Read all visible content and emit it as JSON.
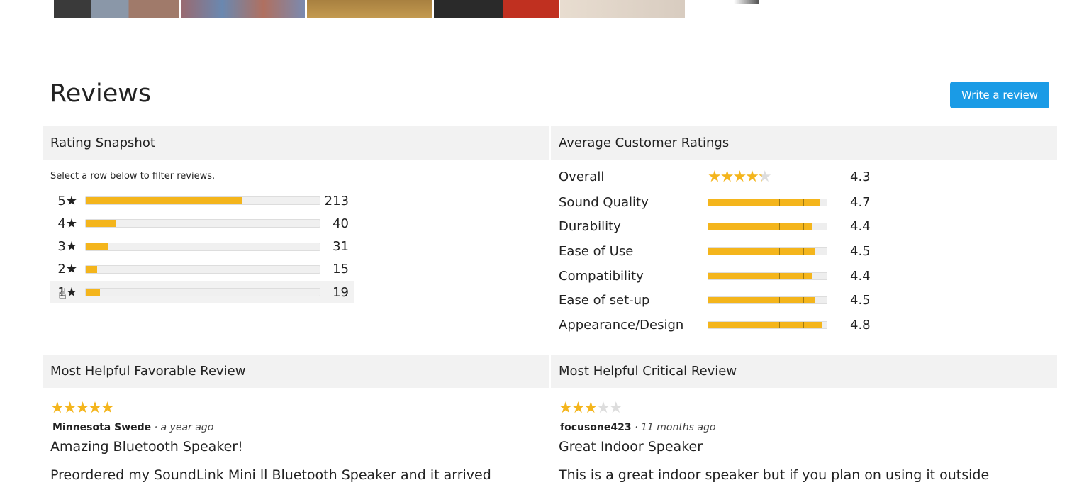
{
  "photos": [
    "photo-1",
    "photo-2",
    "photo-3",
    "photo-4",
    "photo-5"
  ],
  "reviews_title": "Reviews",
  "write_review_label": "Write a review",
  "snapshot": {
    "title": "Rating Snapshot",
    "hint": "Select a row below to filter reviews.",
    "rows": [
      {
        "label": "5★",
        "count": "213",
        "fraction": 0.67
      },
      {
        "label": "4★",
        "count": "40",
        "fraction": 0.126
      },
      {
        "label": "3★",
        "count": "31",
        "fraction": 0.098
      },
      {
        "label": "2★",
        "count": "15",
        "fraction": 0.047
      },
      {
        "label": "1★",
        "count": "19",
        "fraction": 0.06
      }
    ]
  },
  "averages": {
    "title": "Average Customer Ratings",
    "overall": {
      "label": "Overall",
      "value": "4.3"
    },
    "items": [
      {
        "label": "Sound Quality",
        "value": "4.7"
      },
      {
        "label": "Durability",
        "value": "4.4"
      },
      {
        "label": "Ease of Use",
        "value": "4.5"
      },
      {
        "label": "Compatibility",
        "value": "4.4"
      },
      {
        "label": "Ease of set-up",
        "value": "4.5"
      },
      {
        "label": "Appearance/Design",
        "value": "4.8"
      }
    ]
  },
  "favorable": {
    "title": "Most Helpful Favorable Review",
    "stars": 5,
    "author": "Minnesota Swede",
    "when": "· a year ago",
    "headline": "Amazing Bluetooth Speaker!",
    "body": "Preordered my SoundLink Mini ll Bluetooth Speaker and it arrived"
  },
  "critical": {
    "title": "Most Helpful Critical Review",
    "stars": 3,
    "author": "focusone423",
    "when": "· 11 months ago",
    "headline": "Great Indoor Speaker",
    "body": "This is a great indoor speaker but if you plan on using it outside"
  },
  "colors": {
    "accent": "#1a9be6",
    "star": "#f4b51c"
  }
}
